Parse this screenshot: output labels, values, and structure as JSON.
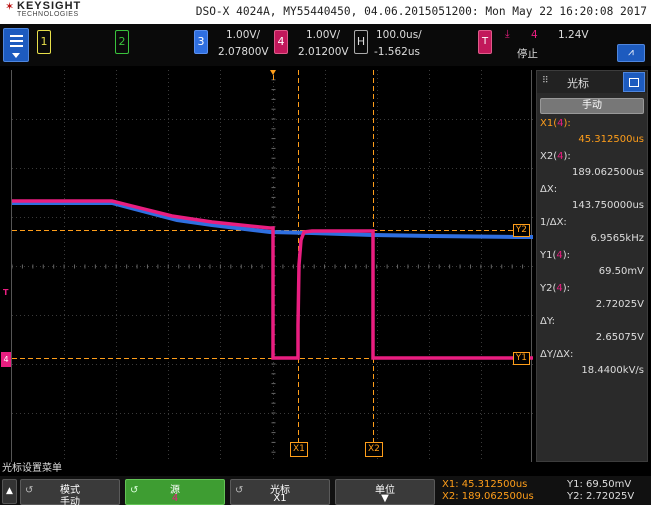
{
  "brand": {
    "name": "KEYSIGHT",
    "sub": "TECHNOLOGIES"
  },
  "title": "DSO-X 4024A, MY55440450, 04.06.2015051200: Mon May 22 16:20:08 2017",
  "colors": {
    "ch1": "#e8e04a",
    "ch2": "#39c23c",
    "ch3": "#2f6fe0",
    "ch4": "#e91e80",
    "cursor": "#ff9e1a",
    "accent_blue": "#1d5bbf",
    "softkey_green": "#3e9d32"
  },
  "channels": {
    "ch1": {
      "label": "1"
    },
    "ch2": {
      "label": "2"
    },
    "ch3": {
      "label": "3",
      "scale": "1.00V/",
      "offset": "2.07800V"
    },
    "ch4": {
      "label": "4",
      "scale": "1.00V/",
      "offset": "2.01200V"
    }
  },
  "horizontal": {
    "label": "H",
    "scale": "100.0us/",
    "position": "-1.562us"
  },
  "trigger": {
    "label": "T",
    "slope_icon": "falling-edge-icon",
    "source": "4",
    "level": "1.24V",
    "status": "停止"
  },
  "autoscale_icon": "autoscale-icon",
  "panel": {
    "title": "光标",
    "mode": "手动",
    "rows": [
      {
        "label": "X1(",
        "src": "4",
        "label_end": "):",
        "value": "45.312500us"
      },
      {
        "label": "X2(",
        "src": "4",
        "label_end": "):",
        "value": "189.062500us"
      },
      {
        "label": "ΔX:",
        "value": "143.750000us"
      },
      {
        "label": "1/ΔX:",
        "value": "6.9565kHz"
      },
      {
        "label": "Y1(",
        "src": "4",
        "label_end": "):",
        "value": "69.50mV"
      },
      {
        "label": "Y2(",
        "src": "4",
        "label_end": "):",
        "value": "2.72025V"
      },
      {
        "label": "ΔY:",
        "value": "2.65075V"
      },
      {
        "label": "ΔY/ΔX:",
        "value": "18.4400kV/s"
      }
    ]
  },
  "markers": {
    "x1": "X1",
    "x2": "X2",
    "y1": "Y1",
    "y2": "Y2",
    "trig": "T"
  },
  "softmenu": {
    "label": "光标设置菜单",
    "keys": [
      {
        "top": "模式",
        "bottom": "手动"
      },
      {
        "top": "源",
        "bottom": "4"
      },
      {
        "top": "光标",
        "bottom": "X1"
      },
      {
        "top": "单位",
        "bottom": ""
      }
    ]
  },
  "readout": {
    "x1": "X1:  45.312500us",
    "x2": "X2:  189.062500us",
    "y1": "Y1: 69.50mV",
    "y2": "Y2: 2.72025V"
  }
}
